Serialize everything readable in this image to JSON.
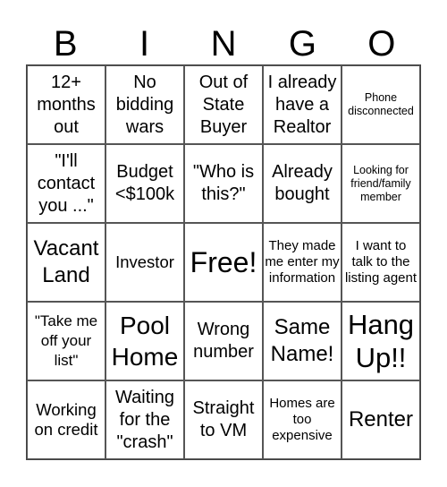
{
  "header": [
    "B",
    "I",
    "N",
    "G",
    "O"
  ],
  "cells": [
    "12+ months out",
    "No bidding wars",
    "Out of State Buyer",
    "I already have a Realtor",
    "Phone disconnected",
    "\"I'll contact you ...\"",
    "Budget <$100k",
    "\"Who is this?\"",
    "Already bought",
    "Looking for friend/family member",
    "Vacant Land",
    "Investor",
    "Free!",
    "They made me enter my information",
    "I want to talk to the listing agent",
    "\"Take me off your list\"",
    "Pool Home",
    "Wrong number",
    "Same Name!",
    "Hang Up!!",
    "Working on credit",
    "Waiting for the \"crash\"",
    "Straight to VM",
    "Homes are too expensive",
    "Renter"
  ]
}
